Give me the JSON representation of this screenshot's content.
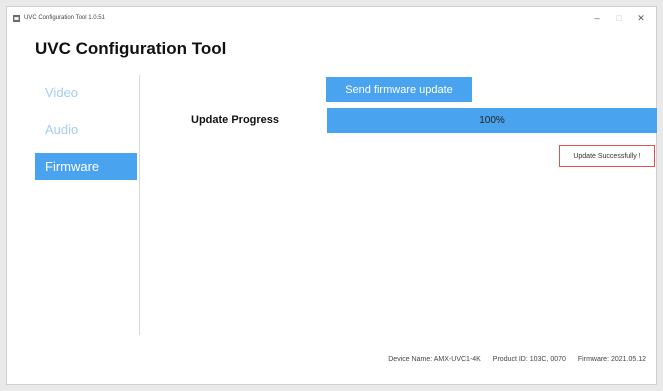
{
  "window": {
    "title": "UVC Configuration Tool 1.0.51",
    "controls": {
      "minimize": "–",
      "maximize": "□",
      "close": "✕"
    }
  },
  "app_title": "UVC Configuration Tool",
  "sidebar": {
    "items": [
      {
        "label": "Video",
        "active": false
      },
      {
        "label": "Audio",
        "active": false
      },
      {
        "label": "Firmware",
        "active": true
      }
    ]
  },
  "firmware": {
    "send_button_label": "Send firmware update",
    "progress_label": "Update Progress",
    "progress_percent": 100,
    "progress_text": "100%",
    "status_message": "Update Successfully !"
  },
  "footer": {
    "device_name": "Device Name: AMX-UVC1-4K",
    "product_id": "Product ID: 103C, 0070",
    "firmware": "Firmware: 2021.05.12"
  },
  "colors": {
    "accent": "#4aa3ef",
    "inactive_nav_text": "#a6cdf2",
    "status_border": "#e05151"
  }
}
